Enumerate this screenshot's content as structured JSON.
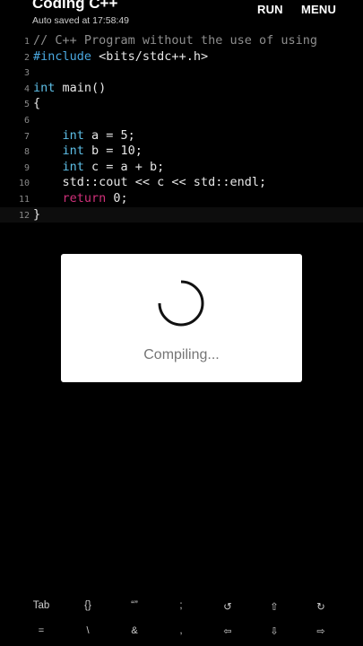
{
  "header": {
    "title": "Coding C++",
    "subtitle": "Auto saved at 17:58:49",
    "run_label": "RUN",
    "menu_label": "MENU"
  },
  "editor": {
    "line_numbers": [
      "1",
      "2",
      "3",
      "4",
      "5",
      "6",
      "7",
      "8",
      "9",
      "10",
      "11",
      "12"
    ],
    "lines": {
      "l1_comment": "// C++ Program without the use of using",
      "l2_directive": "#include",
      "l2_rest": " <bits/stdc++.h>",
      "l4_type": "int",
      "l4_rest": " main()",
      "l5": "{",
      "l7_indent": "    ",
      "l7_type": "int",
      "l7_rest": " a = 5;",
      "l8_type": "int",
      "l8_rest": " b = 10;",
      "l9_type": "int",
      "l9_rest": " c = a + b;",
      "l10": "    std::cout << c << std::endl;",
      "l11_kw": "return",
      "l11_rest": " 0;",
      "l12": "}"
    }
  },
  "dialog": {
    "message": "Compiling..."
  },
  "keyboard_bar": {
    "row1": [
      "Tab",
      "{}",
      "“”",
      ";",
      "↺",
      "⇧",
      "↻"
    ],
    "row2": [
      "=",
      "\\",
      "&",
      ",",
      "⇦",
      "⇩",
      "⇨"
    ]
  },
  "colors": {
    "background": "#000000",
    "keyword_pink": "#d0307a",
    "type_blue": "#5ec0e8",
    "directive_blue": "#4aa8e0",
    "comment_grey": "#8e8e8e"
  }
}
